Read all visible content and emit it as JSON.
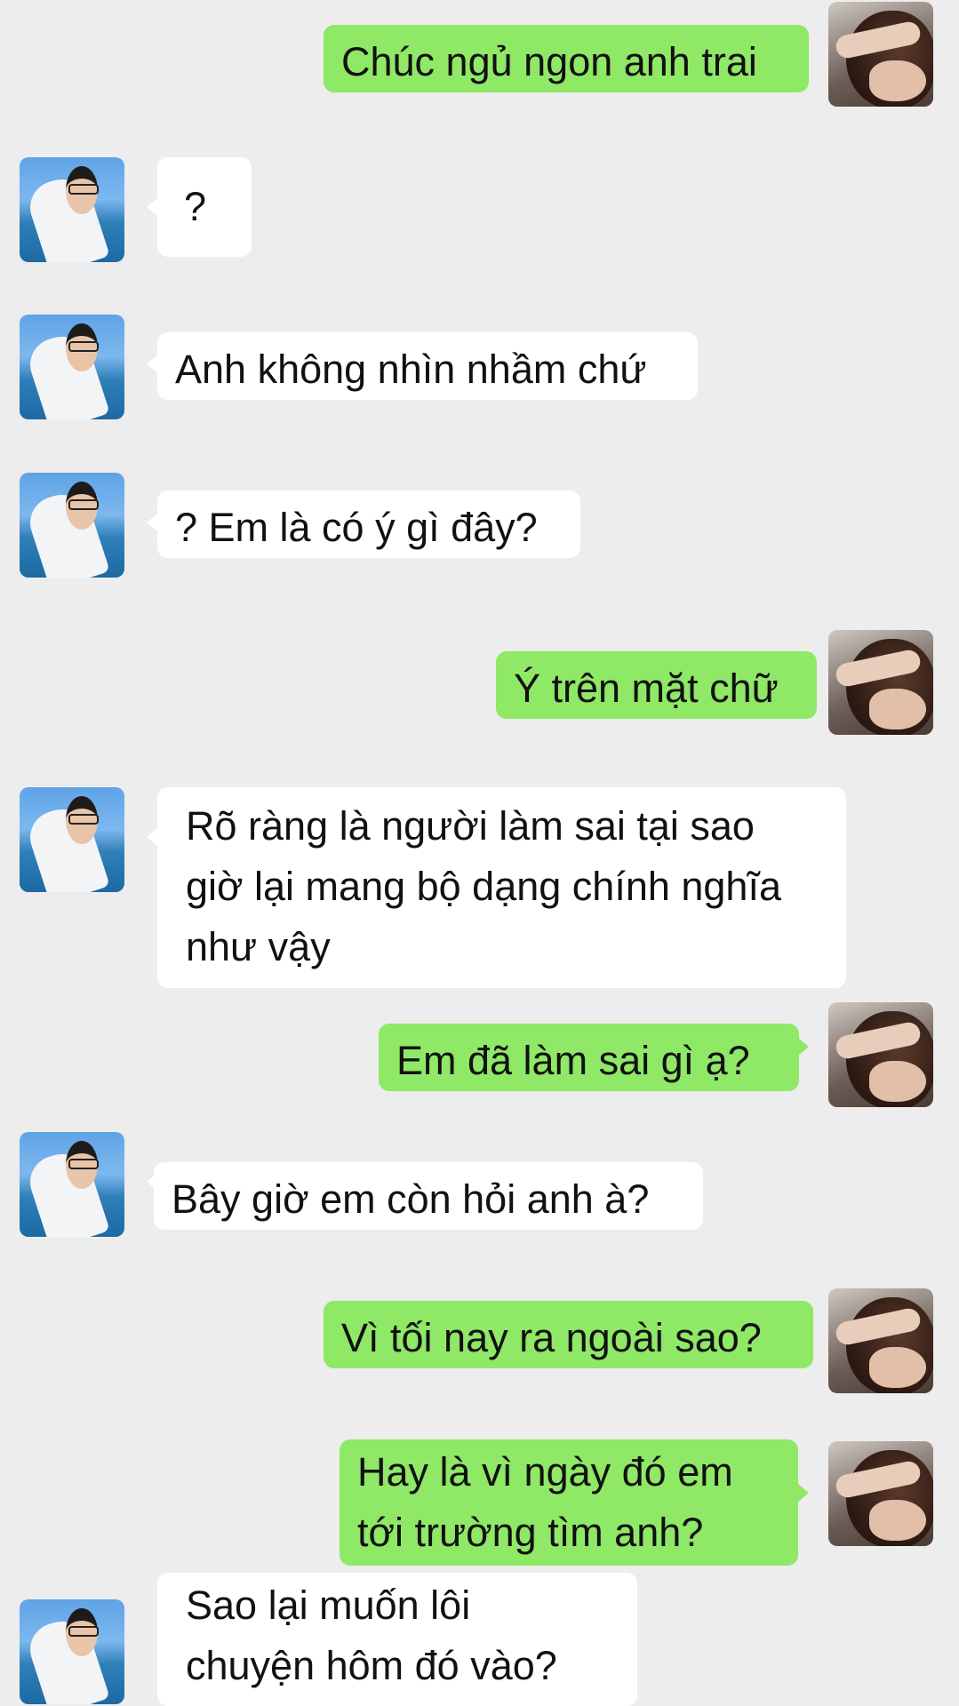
{
  "chat": {
    "messages": [
      {
        "side": "out",
        "text": "Chúc ngủ ngon anh trai"
      },
      {
        "side": "in",
        "text": "?"
      },
      {
        "side": "in",
        "text": "Anh không nhìn nhầm chứ"
      },
      {
        "side": "in",
        "text": "? Em là có ý gì đây?"
      },
      {
        "side": "out",
        "text": "Ý trên mặt chữ"
      },
      {
        "side": "in",
        "lines": [
          "Rõ ràng là người làm sai tại sao",
          "giờ lại mang bộ dạng chính nghĩa",
          "như vậy"
        ]
      },
      {
        "side": "out",
        "text": "Em đã làm sai gì ạ?"
      },
      {
        "side": "in",
        "text": "Bây giờ em còn hỏi anh à?"
      },
      {
        "side": "out",
        "text": "Vì tối nay ra ngoài sao?"
      },
      {
        "side": "out",
        "lines": [
          "Hay là vì ngày đó em",
          "tới trường tìm anh?"
        ]
      },
      {
        "side": "in",
        "lines": [
          "Sao lại muốn lôi",
          "chuyện hôm đó vào?"
        ]
      }
    ]
  },
  "colors": {
    "background": "#ededed",
    "incoming_bubble": "#ffffff",
    "outgoing_bubble": "#8fe866"
  },
  "icons": {
    "contact_avatar": "avatar-boy-by-sea",
    "self_avatar": "avatar-hand-over-hair"
  }
}
